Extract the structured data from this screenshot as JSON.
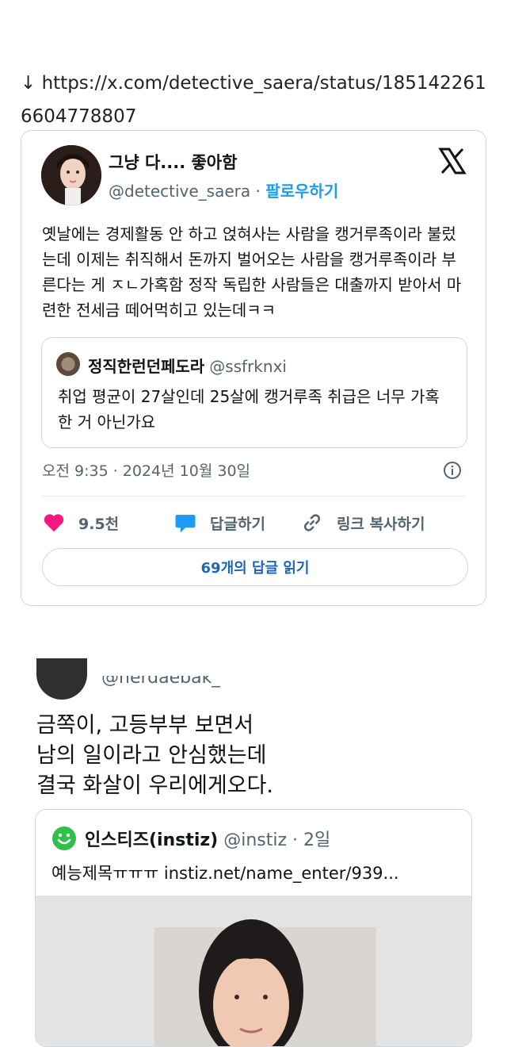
{
  "source_link": "↓ https://x.com/detective_saera/status/1851422616604778807",
  "tweet": {
    "display_name": "그냥 다.... 좋아함",
    "handle": "@detective_saera",
    "separator": " · ",
    "follow_label": "팔로우하기",
    "text": "옛날에는 경제활동 안 하고 얹혀사는 사람을 캥거루족이라 불렀는데 이제는 취직해서 돈까지 벌어오는 사람을 캥거루족이라 부른다는 게 ㅈㄴ가혹함 정작 독립한 사람들은 대출까지 받아서 마련한 전세금 떼어먹히고 있는데ㅋㅋ",
    "quote": {
      "display_name": "정직한런던페도라",
      "handle": "@ssfrknxi",
      "text": "취업 평균이 27살인데 25살에 캥거루족 취급은 너무 가혹한 거 아닌가요"
    },
    "timestamp": "오전 9:35 · 2024년 10월 30일",
    "likes": "9.5천",
    "reply_label": "답글하기",
    "copy_link_label": "링크 복사하기",
    "read_replies_label": "69개의 답글 읽기"
  },
  "lower": {
    "handle_cropped": "@nerdaebak_",
    "text_lines": [
      "금쪽이, 고등부부 보면서",
      "남의 일이라고 안심했는데",
      "결국 화살이 우리에게오다."
    ],
    "quote": {
      "display_name": "인스티즈(instiz)",
      "meta": " @instiz · 2일",
      "text": "예능제목ㅠㅠㅠ instiz.net/name_enter/939..."
    }
  },
  "colors": {
    "accent_blue": "#1d9bf0",
    "like_pink": "#f91880",
    "border": "#cfd9de",
    "instiz_green": "#2fbf4a"
  },
  "icons": [
    "down-arrow",
    "x-logo-icon",
    "info-icon",
    "heart-icon",
    "reply-bubble-icon",
    "link-icon",
    "smile-icon"
  ]
}
